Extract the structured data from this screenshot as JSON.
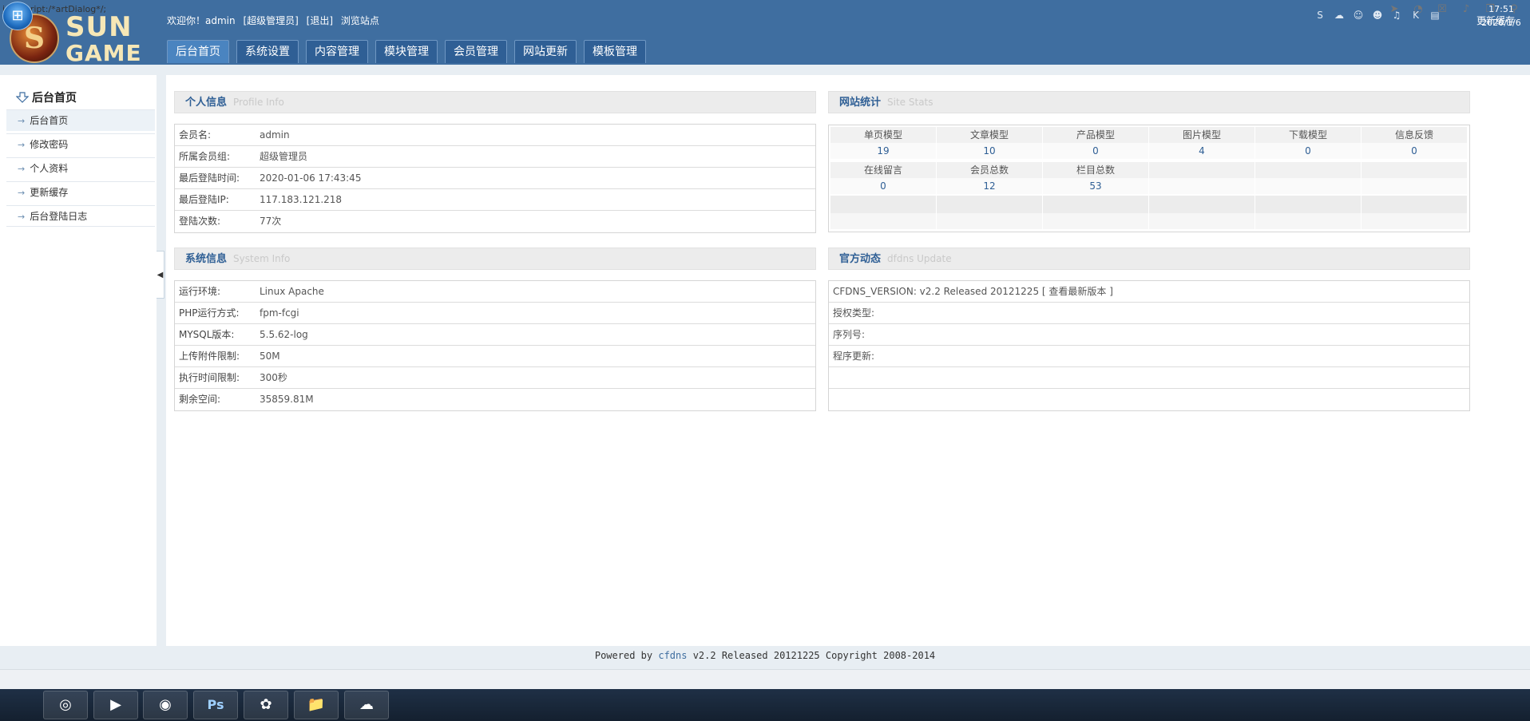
{
  "header": {
    "logo": {
      "line1": "SUN",
      "line2": "GAME"
    },
    "welcome": {
      "greeting": "欢迎你！admin",
      "role": "[超级管理员]",
      "logout": "[退出]",
      "browse": "浏览站点"
    },
    "refresh_cache": "更新缓存",
    "tabs": [
      {
        "label": "后台首页",
        "active": true
      },
      {
        "label": "系统设置"
      },
      {
        "label": "内容管理"
      },
      {
        "label": "模块管理"
      },
      {
        "label": "会员管理"
      },
      {
        "label": "网站更新"
      },
      {
        "label": "模板管理"
      }
    ]
  },
  "sidebar": {
    "title": "后台首页",
    "items": [
      {
        "label": "后台首页",
        "active": true
      },
      {
        "label": "修改密码"
      },
      {
        "label": "个人资料"
      },
      {
        "label": "更新缓存"
      },
      {
        "label": "后台登陆日志"
      }
    ]
  },
  "profile": {
    "title_cn": "个人信息",
    "title_en": "Profile  Info",
    "rows": [
      {
        "key": "会员名:",
        "value": "admin"
      },
      {
        "key": "所属会员组:",
        "value": "超级管理员"
      },
      {
        "key": "最后登陆时间:",
        "value": "2020-01-06 17:43:45"
      },
      {
        "key": "最后登陆IP:",
        "value": "117.183.121.218"
      },
      {
        "key": "登陆次数:",
        "value": "77次"
      }
    ]
  },
  "site_stats": {
    "title_cn": "网站统计",
    "title_en": "Site  Stats",
    "row1": [
      {
        "label": "单页模型",
        "value": "19"
      },
      {
        "label": "文章模型",
        "value": "10"
      },
      {
        "label": "产品模型",
        "value": "0"
      },
      {
        "label": "图片模型",
        "value": "4"
      },
      {
        "label": "下载模型",
        "value": "0"
      },
      {
        "label": "信息反馈",
        "value": "0"
      }
    ],
    "row2": [
      {
        "label": "在线留言",
        "value": "0"
      },
      {
        "label": "会员总数",
        "value": "12"
      },
      {
        "label": "栏目总数",
        "value": "53"
      },
      {
        "label": "",
        "value": ""
      },
      {
        "label": "",
        "value": ""
      },
      {
        "label": "",
        "value": ""
      }
    ]
  },
  "system": {
    "title_cn": "系统信息",
    "title_en": "System  Info",
    "rows": [
      {
        "key": "运行环境:",
        "value": "Linux Apache"
      },
      {
        "key": "PHP运行方式:",
        "value": "fpm-fcgi"
      },
      {
        "key": "MYSQL版本:",
        "value": "5.5.62-log"
      },
      {
        "key": "上传附件限制:",
        "value": "50M"
      },
      {
        "key": "执行时间限制:",
        "value": "300秒"
      },
      {
        "key": "剩余空间:",
        "value": "35859.81M"
      }
    ]
  },
  "official": {
    "title_cn": "官方动态",
    "title_en": "dfdns Update",
    "version_text": "CFDNS_VERSION: v2.2 Released 20121225 [",
    "version_link": "查看最新版本",
    "version_close": "]",
    "license_type": "授权类型:",
    "serial": "序列号:",
    "program_update": "程序更新:"
  },
  "footer": {
    "prefix": "Powered by",
    "brand": "cfdns",
    "suffix": "v2.2 Released 20121225 Copyright 2008-2014"
  },
  "statusbar": {
    "text": "javascript:/*artDialog*/;"
  },
  "taskbar": {
    "time": "17:51",
    "date": "2020/1/6"
  },
  "colors": {
    "header_bg": "#3f6ea0",
    "accent": "#2f5f95",
    "tab_bg": "#2f5f95"
  }
}
